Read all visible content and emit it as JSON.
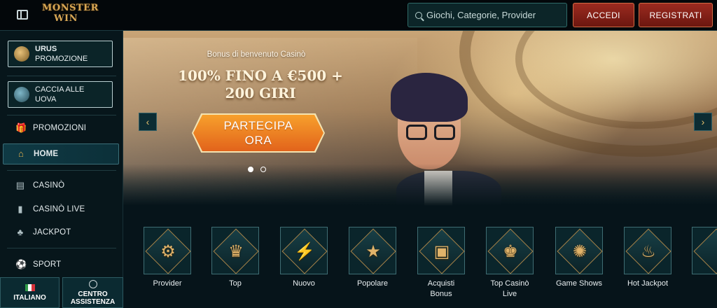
{
  "header": {
    "logo_line1": "MONSTER",
    "logo_line2": "WIN",
    "search_placeholder": "Giochi, Categorie, Provider",
    "login_label": "ACCEDI",
    "register_label": "REGISTRATI"
  },
  "sidebar": {
    "promos": [
      {
        "title": "URUS",
        "subtitle": "PROMOZIONE"
      },
      {
        "title": "CACCIA ALLE",
        "subtitle": "UOVA"
      }
    ],
    "items": [
      {
        "label": "PROMOZIONI",
        "icon": "gift-icon"
      },
      {
        "label": "HOME",
        "icon": "home-icon"
      },
      {
        "label": "CASINÒ",
        "icon": "slot-machine-icon"
      },
      {
        "label": "CASINÒ LIVE",
        "icon": "cards-icon"
      },
      {
        "label": "JACKPOT",
        "icon": "clover-icon"
      },
      {
        "label": "SPORT",
        "icon": "ball-icon"
      }
    ],
    "language_label": "ITALIANO",
    "help_label_1": "CENTRO",
    "help_label_2": "ASSISTENZA"
  },
  "banner": {
    "subtitle": "Bonus di benvenuto Casinò",
    "title_line1": "100% FINO A €500 +",
    "title_line2": "200 GIRI",
    "cta_line1": "PARTECIPA",
    "cta_line2": "ORA",
    "active_slide": 1,
    "slide_count": 2
  },
  "categories": [
    {
      "label": "Provider",
      "icon": "book-icon",
      "glyph": "⚙"
    },
    {
      "label": "Top",
      "icon": "crown-icon",
      "glyph": "♛"
    },
    {
      "label": "Nuovo",
      "icon": "lightning-icon",
      "glyph": "⚡"
    },
    {
      "label": "Popolare",
      "icon": "star-icon",
      "glyph": "★"
    },
    {
      "label": "Acquisti\nBonus",
      "icon": "chest-icon",
      "glyph": "▣"
    },
    {
      "label": "Top Casinò\nLive",
      "icon": "chip-icon",
      "glyph": "♚"
    },
    {
      "label": "Game Shows",
      "icon": "wheel-icon",
      "glyph": "✺"
    },
    {
      "label": "Hot Jackpot",
      "icon": "flame-icon",
      "glyph": "♨"
    }
  ],
  "colors": {
    "accent_gold": "#d8a755",
    "button_red": "#9b2b20",
    "cta_orange": "#f7a02c",
    "sidebar_bg": "#07161b"
  }
}
